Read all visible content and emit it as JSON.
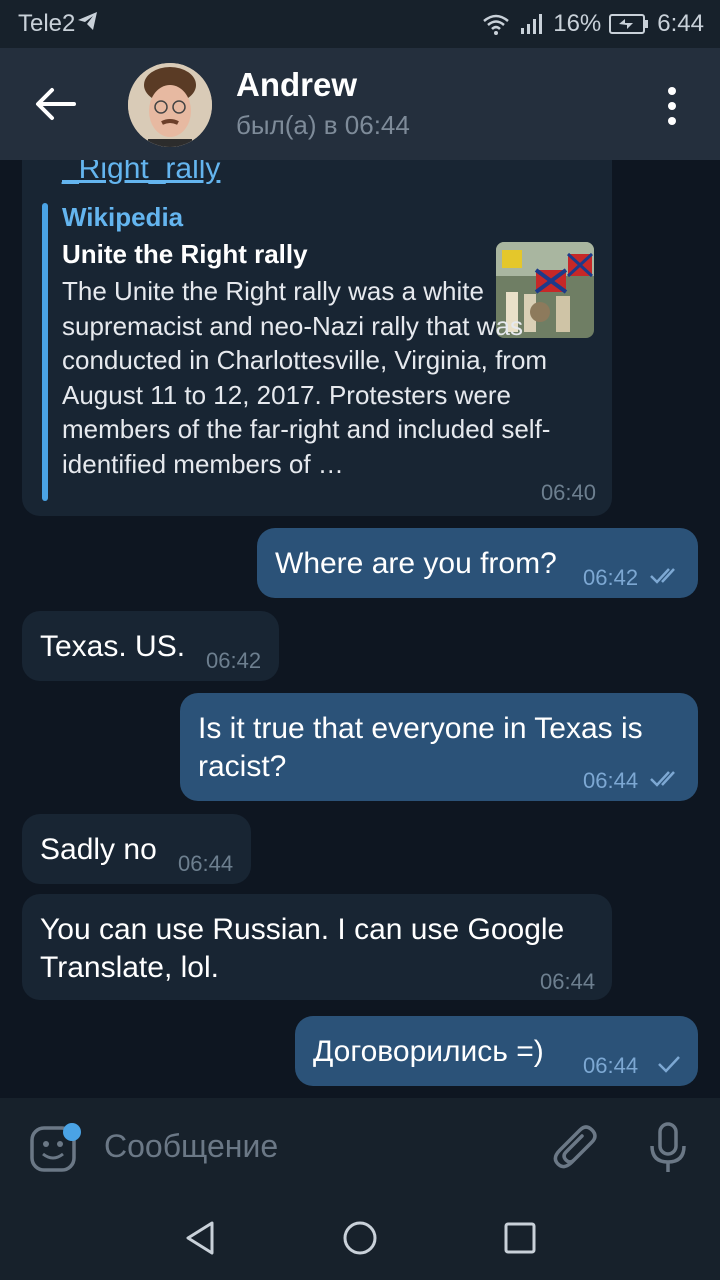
{
  "status_bar": {
    "carrier": "Tele2",
    "battery": "16%",
    "time": "6:44"
  },
  "header": {
    "contact_name": "Andrew",
    "last_seen": "был(а) в 06:44"
  },
  "messages": {
    "link_preview": {
      "link_text": "_Right_rally",
      "site": "Wikipedia",
      "title": "Unite the Right rally",
      "body": "The Unite the Right rally was a white supremacist and neo-Nazi rally that was conducted in Charlottesville, Virginia, from August 11 to 12, 2017. Protesters were members of the far-right and included self-identified members of …",
      "time": "06:40"
    },
    "m1": {
      "text": "Where are you from?",
      "time": "06:42",
      "status": "read"
    },
    "m2": {
      "text": "Texas. US.",
      "time": "06:42"
    },
    "m3": {
      "text": "Is it true that everyone in Texas is racist?",
      "time": "06:44",
      "status": "read"
    },
    "m4": {
      "text": "Sadly no",
      "time": "06:44"
    },
    "m5": {
      "text": "You can use Russian. I can use Google Translate, lol.",
      "time": "06:44"
    },
    "m6": {
      "text": "Договорились =)",
      "time": "06:44",
      "status": "sent"
    }
  },
  "composer": {
    "placeholder": "Сообщение"
  },
  "icons": {
    "back": "back-arrow-icon",
    "menu": "more-vert-icon",
    "sticker": "sticker-icon",
    "attach": "paperclip-icon",
    "mic": "microphone-icon"
  },
  "colors": {
    "background": "#0e1621",
    "incoming_bubble": "#182533",
    "outgoing_bubble": "#2b5278",
    "accent": "#64b5ef"
  }
}
